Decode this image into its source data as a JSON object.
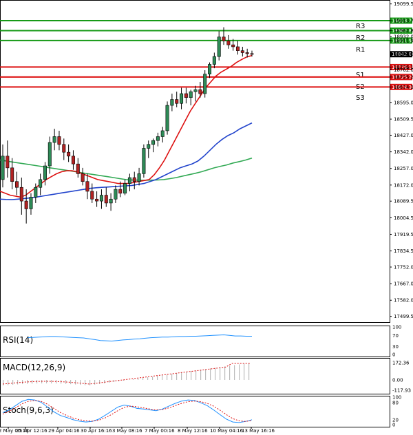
{
  "chart_data": {
    "type": "candlestick",
    "price_axis": {
      "ticks": [
        "19099.5",
        "19013.7",
        "18962.8",
        "18932.0",
        "18911.9",
        "18842.0",
        "18776.1",
        "18762.0",
        "18725.2",
        "18674.3",
        "18595.0",
        "18509.5",
        "18427.0",
        "18342.0",
        "18257.0",
        "18172.0",
        "18089.5",
        "18004.5",
        "17919.5",
        "17834.5",
        "17752.0",
        "17667.0",
        "17582.0",
        "17499.5"
      ],
      "range": [
        17470,
        19116
      ]
    },
    "time_axis": {
      "labels": [
        "2 May 00:16",
        "25 Apr 12:16",
        "29 Apr 04:16",
        "30 Apr 16:16",
        "3 May 08:16",
        "7 May 00:16",
        "8 May 12:16",
        "10 May 04:16",
        "13 May 16:16"
      ]
    },
    "current_price": "18842.0",
    "levels": {
      "resistance": [
        {
          "name": "R3",
          "value": "19013.7",
          "price": 19013.7
        },
        {
          "name": "R2",
          "value": "18962.8",
          "price": 18962.8
        },
        {
          "name": "R1",
          "value": "18911.9",
          "price": 18911.9
        }
      ],
      "support": [
        {
          "name": "S1",
          "value": "18776.1",
          "price": 18776.1
        },
        {
          "name": "S2",
          "value": "18725.2",
          "price": 18725.2
        },
        {
          "name": "S3",
          "value": "18674.3",
          "price": 18674.3
        }
      ]
    },
    "candles": [
      {
        "o": 18200,
        "h": 18380,
        "l": 18160,
        "c": 18320
      },
      {
        "o": 18320,
        "h": 18400,
        "l": 18210,
        "c": 18260
      },
      {
        "o": 18260,
        "h": 18310,
        "l": 18150,
        "c": 18190
      },
      {
        "o": 18190,
        "h": 18240,
        "l": 18120,
        "c": 18160
      },
      {
        "o": 18160,
        "h": 18210,
        "l": 18020,
        "c": 18090
      },
      {
        "o": 18090,
        "h": 18150,
        "l": 17975,
        "c": 18050
      },
      {
        "o": 18050,
        "h": 18130,
        "l": 18020,
        "c": 18110
      },
      {
        "o": 18110,
        "h": 18180,
        "l": 18080,
        "c": 18160
      },
      {
        "o": 18160,
        "h": 18230,
        "l": 18120,
        "c": 18200
      },
      {
        "o": 18200,
        "h": 18290,
        "l": 18170,
        "c": 18270
      },
      {
        "o": 18270,
        "h": 18420,
        "l": 18230,
        "c": 18390
      },
      {
        "o": 18390,
        "h": 18460,
        "l": 18350,
        "c": 18420
      },
      {
        "o": 18420,
        "h": 18450,
        "l": 18350,
        "c": 18380
      },
      {
        "o": 18380,
        "h": 18410,
        "l": 18300,
        "c": 18340
      },
      {
        "o": 18340,
        "h": 18380,
        "l": 18290,
        "c": 18320
      },
      {
        "o": 18320,
        "h": 18350,
        "l": 18250,
        "c": 18280
      },
      {
        "o": 18280,
        "h": 18310,
        "l": 18210,
        "c": 18230
      },
      {
        "o": 18230,
        "h": 18260,
        "l": 18170,
        "c": 18190
      },
      {
        "o": 18190,
        "h": 18230,
        "l": 18100,
        "c": 18140
      },
      {
        "o": 18140,
        "h": 18180,
        "l": 18080,
        "c": 18100
      },
      {
        "o": 18100,
        "h": 18140,
        "l": 18060,
        "c": 18090
      },
      {
        "o": 18090,
        "h": 18150,
        "l": 18050,
        "c": 18120
      },
      {
        "o": 18120,
        "h": 18160,
        "l": 18060,
        "c": 18080
      },
      {
        "o": 18080,
        "h": 18130,
        "l": 18040,
        "c": 18100
      },
      {
        "o": 18100,
        "h": 18170,
        "l": 18080,
        "c": 18150
      },
      {
        "o": 18150,
        "h": 18190,
        "l": 18110,
        "c": 18130
      },
      {
        "o": 18130,
        "h": 18200,
        "l": 18120,
        "c": 18180
      },
      {
        "o": 18180,
        "h": 18230,
        "l": 18140,
        "c": 18210
      },
      {
        "o": 18210,
        "h": 18240,
        "l": 18150,
        "c": 18190
      },
      {
        "o": 18190,
        "h": 18260,
        "l": 18170,
        "c": 18230
      },
      {
        "o": 18230,
        "h": 18380,
        "l": 18210,
        "c": 18360
      },
      {
        "o": 18360,
        "h": 18400,
        "l": 18310,
        "c": 18380
      },
      {
        "o": 18380,
        "h": 18410,
        "l": 18340,
        "c": 18400
      },
      {
        "o": 18400,
        "h": 18440,
        "l": 18370,
        "c": 18420
      },
      {
        "o": 18420,
        "h": 18470,
        "l": 18390,
        "c": 18450
      },
      {
        "o": 18450,
        "h": 18600,
        "l": 18430,
        "c": 18580
      },
      {
        "o": 18580,
        "h": 18640,
        "l": 18550,
        "c": 18610
      },
      {
        "o": 18610,
        "h": 18650,
        "l": 18570,
        "c": 18590
      },
      {
        "o": 18590,
        "h": 18670,
        "l": 18560,
        "c": 18640
      },
      {
        "o": 18640,
        "h": 18670,
        "l": 18590,
        "c": 18620
      },
      {
        "o": 18620,
        "h": 18660,
        "l": 18580,
        "c": 18650
      },
      {
        "o": 18650,
        "h": 18680,
        "l": 18600,
        "c": 18660
      },
      {
        "o": 18660,
        "h": 18700,
        "l": 18620,
        "c": 18640
      },
      {
        "o": 18640,
        "h": 18760,
        "l": 18620,
        "c": 18740
      },
      {
        "o": 18740,
        "h": 18800,
        "l": 18720,
        "c": 18790
      },
      {
        "o": 18790,
        "h": 18850,
        "l": 18770,
        "c": 18830
      },
      {
        "o": 18830,
        "h": 18960,
        "l": 18810,
        "c": 18930
      },
      {
        "o": 18930,
        "h": 18980,
        "l": 18890,
        "c": 18910
      },
      {
        "o": 18910,
        "h": 18940,
        "l": 18870,
        "c": 18890
      },
      {
        "o": 18890,
        "h": 18920,
        "l": 18860,
        "c": 18880
      },
      {
        "o": 18880,
        "h": 18910,
        "l": 18840,
        "c": 18860
      },
      {
        "o": 18860,
        "h": 18880,
        "l": 18830,
        "c": 18850
      },
      {
        "o": 18850,
        "h": 18870,
        "l": 18825,
        "c": 18845
      },
      {
        "o": 18845,
        "h": 18860,
        "l": 18830,
        "c": 18842
      }
    ],
    "ma_red": [
      18140,
      18130,
      18120,
      18115,
      18110,
      18120,
      18140,
      18160,
      18180,
      18200,
      18215,
      18230,
      18240,
      18245,
      18245,
      18240,
      18230,
      18220,
      18210,
      18200,
      18195,
      18190,
      18185,
      18180,
      18180,
      18180,
      18185,
      18190,
      18195,
      18200,
      18225,
      18260,
      18300,
      18350,
      18400,
      18450,
      18500,
      18550,
      18590,
      18630,
      18670,
      18700,
      18730,
      18750,
      18765,
      18780,
      18800,
      18815,
      18828,
      18835
    ],
    "ma_blue": [
      18100,
      18098,
      18097,
      18100,
      18103,
      18106,
      18110,
      18115,
      18120,
      18125,
      18130,
      18135,
      18140,
      18145,
      18150,
      18155,
      18158,
      18160,
      18162,
      18164,
      18166,
      18168,
      18170,
      18175,
      18180,
      18190,
      18200,
      18215,
      18230,
      18245,
      18260,
      18270,
      18280,
      18295,
      18320,
      18350,
      18380,
      18405,
      18425,
      18440,
      18460,
      18475,
      18490
    ],
    "ma_green": [
      18300,
      18295,
      18290,
      18285,
      18280,
      18275,
      18270,
      18265,
      18260,
      18255,
      18250,
      18245,
      18240,
      18235,
      18230,
      18225,
      18220,
      18215,
      18210,
      18205,
      18200,
      18198,
      18197,
      18196,
      18197,
      18198,
      18200,
      18205,
      18210,
      18218,
      18225,
      18232,
      18240,
      18250,
      18260,
      18268,
      18275,
      18285,
      18292,
      18300,
      18310
    ],
    "indicators": {
      "rsi": {
        "title": "RSI(14)",
        "ticks": [
          "100",
          "70",
          "30",
          "0"
        ],
        "values": [
          62,
          63,
          64,
          65,
          66,
          66,
          65,
          64,
          63,
          62,
          61,
          58,
          55,
          52,
          51,
          50,
          52,
          54,
          55,
          57,
          58,
          60,
          62,
          63,
          64,
          64,
          65,
          66,
          66,
          67,
          67,
          68,
          69,
          70,
          71,
          72,
          70,
          68,
          68,
          67,
          67
        ]
      },
      "macd": {
        "title": "MACD(12,26,9)",
        "ticks": [
          "172.36",
          "0.00",
          "-117.93"
        ]
      },
      "stoch": {
        "title": "Stoch(9,6,3)",
        "ticks": [
          "100",
          "80",
          "20",
          "0"
        ]
      }
    }
  }
}
